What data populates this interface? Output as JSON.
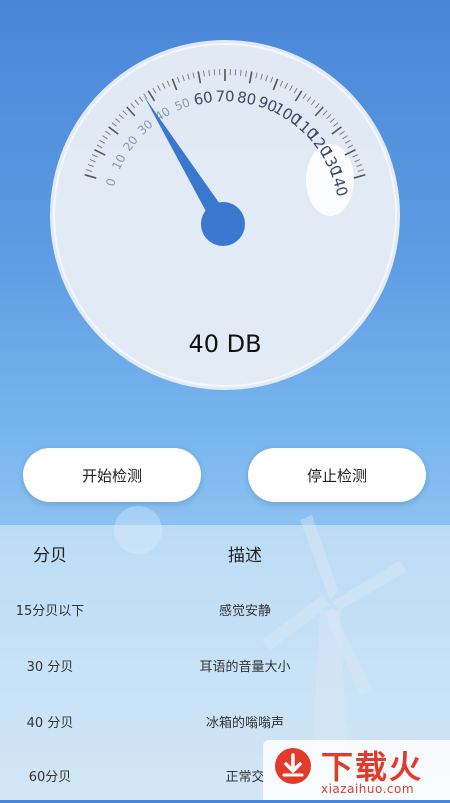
{
  "gauge": {
    "reading_label": "40 DB",
    "value": 40,
    "min": 0,
    "max": 140,
    "tick_labels": [
      "0",
      "10",
      "20",
      "30",
      "40",
      "50",
      "60",
      "70",
      "80",
      "90",
      "100",
      "110",
      "120",
      "130",
      "140"
    ],
    "needle_color": "#3a78d0",
    "face_color": "#e9eef6"
  },
  "buttons": {
    "start_label": "开始检测",
    "stop_label": "停止检测"
  },
  "table": {
    "headers": {
      "level": "分贝",
      "description": "描述"
    },
    "rows": [
      {
        "level": "15分贝以下",
        "description": "感觉安静"
      },
      {
        "level": "30 分贝",
        "description": "耳语的音量大小"
      },
      {
        "level": "40 分贝",
        "description": "冰箱的嗡嗡声"
      },
      {
        "level": "60分贝",
        "description": "正常交"
      }
    ]
  },
  "watermark": {
    "title": "下载火",
    "subtitle": "xiazaihuo.com",
    "color": "#e23b2a"
  }
}
